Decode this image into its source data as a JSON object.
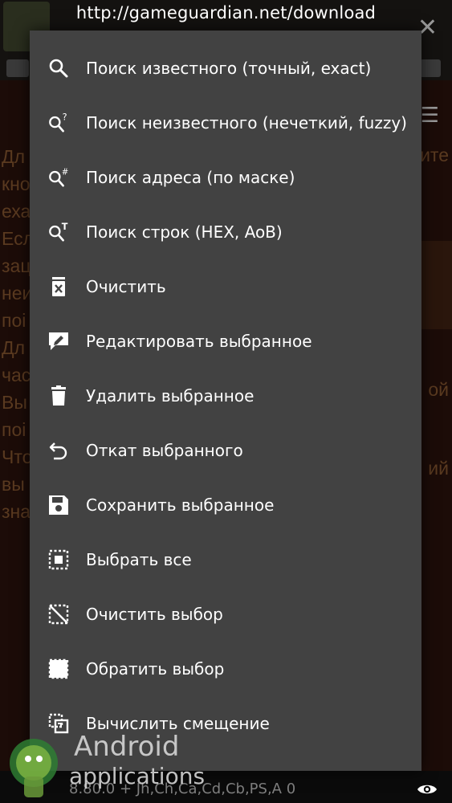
{
  "banner": {
    "url": "http://gameguardian.net/download"
  },
  "background": {
    "text_fragments": [
      "Дл",
      "кно",
      "еха",
      "Есл",
      "зац",
      "неи",
      "поі",
      "Дл",
      "час",
      "Вы",
      "поі",
      "Что",
      "вы",
      "зна"
    ],
    "right_fragments": [
      "ите",
      "ой",
      "ий"
    ],
    "status_line": "8.80.0  + Jh,Ch,Ca,Cd,Cb,PS,A   0"
  },
  "menu": {
    "items": [
      {
        "label": "Поиск известного (точный, exact)",
        "icon": "search-icon"
      },
      {
        "label": "Поиск неизвестного (нечеткий, fuzzy)",
        "icon": "search-question-icon"
      },
      {
        "label": "Поиск адреса (по маске)",
        "icon": "search-hash-icon"
      },
      {
        "label": "Поиск строк (HEX, AoB)",
        "icon": "search-text-icon"
      },
      {
        "label": "Очистить",
        "icon": "clear-icon"
      },
      {
        "label": "Редактировать выбранное",
        "icon": "edit-icon"
      },
      {
        "label": "Удалить выбранное",
        "icon": "trash-icon"
      },
      {
        "label": "Откат выбранного",
        "icon": "undo-icon"
      },
      {
        "label": "Сохранить выбранное",
        "icon": "save-icon"
      },
      {
        "label": "Выбрать все",
        "icon": "select-all-icon"
      },
      {
        "label": "Очистить выбор",
        "icon": "select-none-icon"
      },
      {
        "label": "Обратить выбор",
        "icon": "invert-selection-icon"
      },
      {
        "label": "Вычислить смещение",
        "icon": "offset-icon"
      }
    ]
  },
  "watermark": {
    "line1": "Android",
    "line2": "applications"
  },
  "colors": {
    "dialog": "#424242",
    "text": "#ffffff",
    "icon": "#ffffff"
  }
}
